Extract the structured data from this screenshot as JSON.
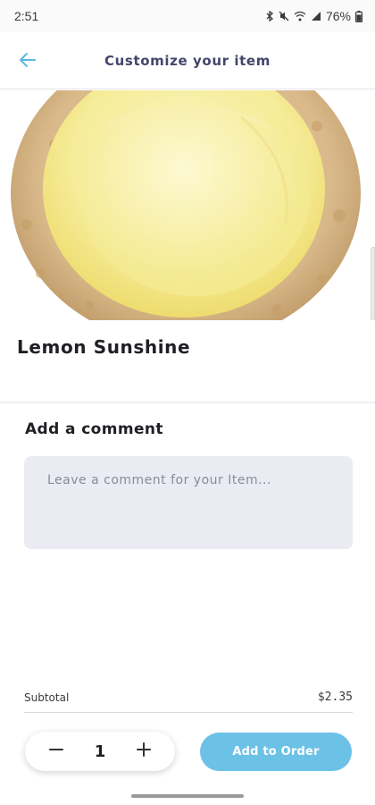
{
  "status_bar": {
    "time": "2:51",
    "battery": "76%"
  },
  "header": {
    "title": "Customize your item",
    "back_icon": "arrow-left-icon"
  },
  "product": {
    "name": "Lemon Sunshine",
    "image": "lemon-frosted-cookie"
  },
  "comment": {
    "heading": "Add a comment",
    "placeholder": "Leave a comment for your Item...",
    "value": ""
  },
  "order": {
    "subtotal_label": "Subtotal",
    "subtotal_value": "$2.35",
    "quantity": "1",
    "minus_icon": "minus-icon",
    "plus_icon": "plus-icon",
    "add_label": "Add to Order"
  },
  "colors": {
    "accent": "#6cc1e6",
    "header_title": "#43456b",
    "comment_bg": "#ebebf3"
  }
}
